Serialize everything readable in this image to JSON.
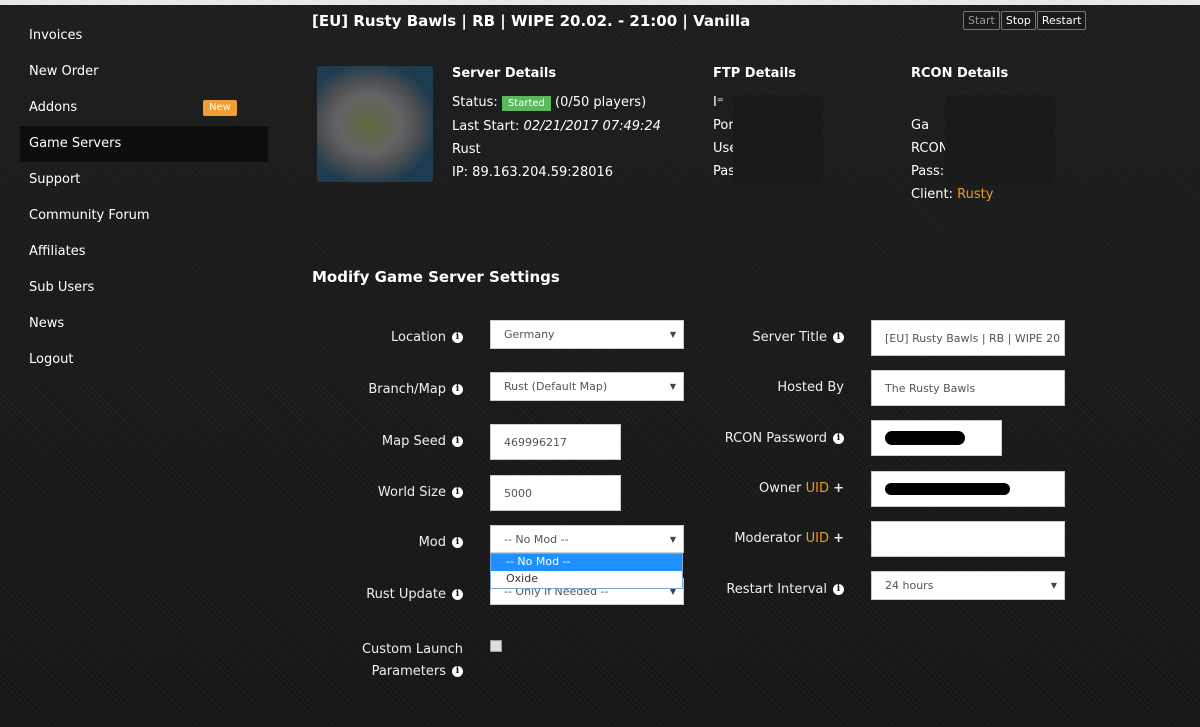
{
  "sidebar": {
    "items": [
      {
        "label": "Invoices"
      },
      {
        "label": "New Order"
      },
      {
        "label": "Addons",
        "badge": "New"
      },
      {
        "label": "Game Servers",
        "active": true
      },
      {
        "label": "Support"
      },
      {
        "label": "Community Forum"
      },
      {
        "label": "Affiliates"
      },
      {
        "label": "Sub Users"
      },
      {
        "label": "News"
      },
      {
        "label": "Logout"
      }
    ]
  },
  "header": {
    "title": "[EU] Rusty Bawls | RB | WIPE 20.02. - 21:00 | Vanilla",
    "start": "Start",
    "stop": "Stop",
    "restart": "Restart"
  },
  "server": {
    "heading": "Server Details",
    "status_label": "Status:",
    "status": "Started",
    "status_color": "#5cb85c",
    "players": "(0/50 players)",
    "last_start_label": "Last Start:",
    "last_start": "02/21/2017 07:49:24",
    "game": "Rust",
    "ip": "IP: 89.163.204.59:28016"
  },
  "ftp": {
    "heading": "FTP Details",
    "lines": [
      "I⁼",
      "Por",
      "User",
      "Pass"
    ]
  },
  "rcon": {
    "heading": "RCON Details",
    "lines": [
      "Ga",
      "RCON",
      "Pass:"
    ],
    "client_label": "Client:",
    "client": "Rusty"
  },
  "settings": {
    "heading": "Modify Game Server Settings",
    "location": {
      "label": "Location",
      "value": "Germany"
    },
    "branch": {
      "label": "Branch/Map",
      "value": "Rust (Default Map)"
    },
    "seed": {
      "label": "Map Seed",
      "value": "469996217"
    },
    "world": {
      "label": "World Size",
      "value": "5000"
    },
    "mod": {
      "label": "Mod",
      "value": "-- No Mod --",
      "options": [
        "-- No Mod --",
        "Oxide"
      ]
    },
    "update": {
      "label": "Rust Update",
      "value": "-- Only if Needed --"
    },
    "custom": {
      "label1": "Custom Launch",
      "label2": "Parameters",
      "checked": false
    },
    "title": {
      "label": "Server Title",
      "value": "[EU] Rusty Bawls | RB | WIPE 20"
    },
    "hosted": {
      "label": "Hosted By",
      "value": "The Rusty Bawls"
    },
    "rconpw": {
      "label": "RCON Password"
    },
    "owner": {
      "label": "Owner",
      "uid": "UID"
    },
    "moderator": {
      "label": "Moderator",
      "uid": "UID"
    },
    "restart": {
      "label": "Restart Interval",
      "value": "24 hours"
    }
  }
}
